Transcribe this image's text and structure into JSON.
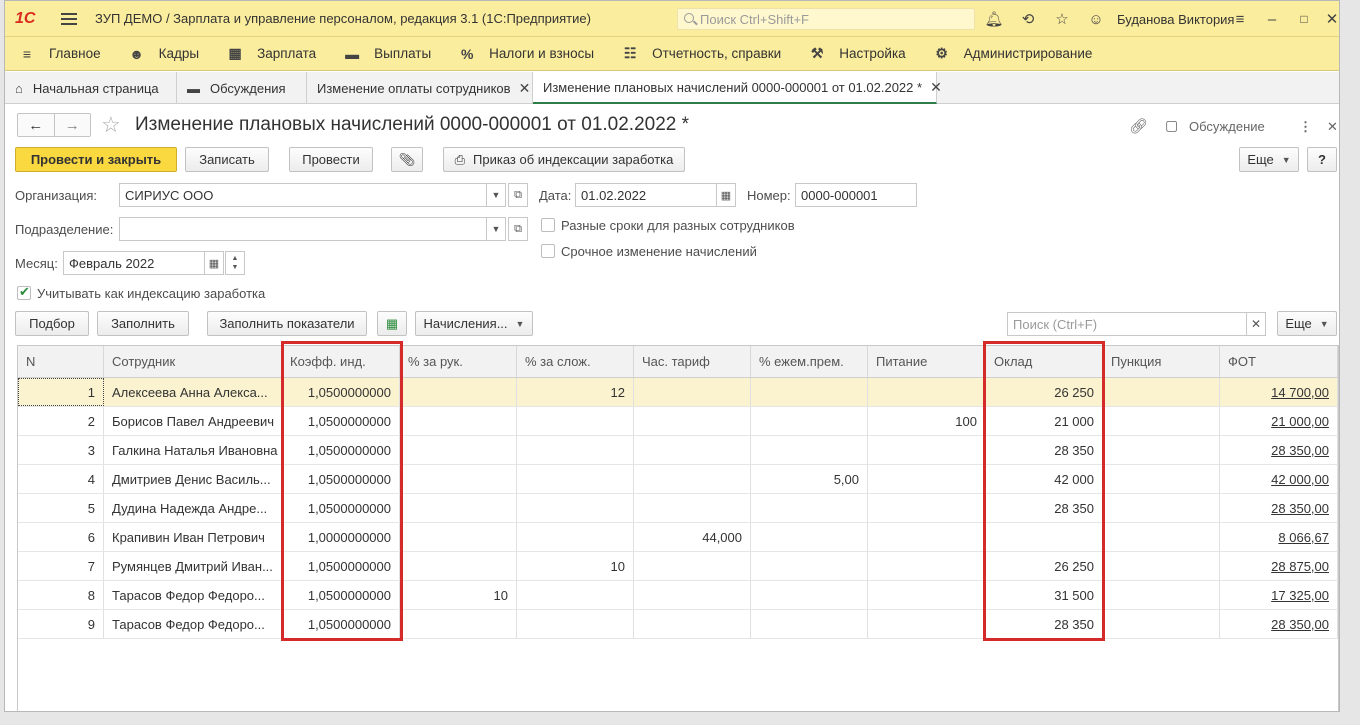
{
  "titlebar": {
    "logo": "1С",
    "title": "ЗУП ДЕМО / Зарплата и управление персоналом, редакция 3.1  (1С:Предприятие)",
    "search_placeholder": "Поиск Ctrl+Shift+F",
    "user": "Буданова Виктория"
  },
  "menu": [
    {
      "label": "Главное",
      "icon": "menu-icon"
    },
    {
      "label": "Кадры",
      "icon": "people-icon"
    },
    {
      "label": "Зарплата",
      "icon": "calculator-icon"
    },
    {
      "label": "Выплаты",
      "icon": "wallet-icon"
    },
    {
      "label": "Налоги и взносы",
      "icon": "percent-icon"
    },
    {
      "label": "Отчетность, справки",
      "icon": "report-icon"
    },
    {
      "label": "Настройка",
      "icon": "wrench-icon"
    },
    {
      "label": "Администрирование",
      "icon": "gear-icon"
    }
  ],
  "tabs": [
    {
      "label": "Начальная страница"
    },
    {
      "label": "Обсуждения"
    },
    {
      "label": "Изменение оплаты сотрудников"
    },
    {
      "label": "Изменение плановых начислений 0000-000001 от 01.02.2022 *"
    }
  ],
  "form": {
    "title": "Изменение плановых начислений 0000-000001 от 01.02.2022 *",
    "discussion": "Обсуждение",
    "buttons": {
      "post_close": "Провести и закрыть",
      "save": "Записать",
      "post": "Провести",
      "order": "Приказ об индексации заработка",
      "more": "Еще",
      "help": "?"
    },
    "org_label": "Организация:",
    "org_value": "СИРИУС ООО",
    "date_label": "Дата:",
    "date_value": "01.02.2022",
    "number_label": "Номер:",
    "number_value": "0000-000001",
    "dept_label": "Подразделение:",
    "dept_value": "",
    "check_terms": "Разные сроки для разных сотрудников",
    "check_urgent": "Срочное изменение начислений",
    "month_label": "Месяц:",
    "month_value": "Февраль 2022",
    "check_indexation": "Учитывать как индексацию заработка"
  },
  "table_toolbar": {
    "pick": "Подбор",
    "fill": "Заполнить",
    "fill_indicators": "Заполнить показатели",
    "accruals": "Начисления...",
    "search_placeholder": "Поиск (Ctrl+F)",
    "more": "Еще"
  },
  "table": {
    "columns": [
      "N",
      "Сотрудник",
      "Коэфф. инд.",
      "% за рук.",
      "% за слож.",
      "Час. тариф",
      "% ежем.прем.",
      "Питание",
      "Оклад",
      "Пункция",
      "ФОТ"
    ],
    "rows": [
      [
        "1",
        "Алексеева Анна Алекса...",
        "1,0500000000",
        "",
        "12",
        "",
        "",
        "",
        "26 250",
        "",
        "14 700,00"
      ],
      [
        "2",
        "Борисов Павел Андреевич",
        "1,0500000000",
        "",
        "",
        "",
        "",
        "100",
        "21 000",
        "",
        "21 000,00"
      ],
      [
        "3",
        "Галкина Наталья Ивановна",
        "1,0500000000",
        "",
        "",
        "",
        "",
        "",
        "28 350",
        "",
        "28 350,00"
      ],
      [
        "4",
        "Дмитриев Денис Василь...",
        "1,0500000000",
        "",
        "",
        "",
        "5,00",
        "",
        "42 000",
        "",
        "42 000,00"
      ],
      [
        "5",
        "Дудина Надежда Андре...",
        "1,0500000000",
        "",
        "",
        "",
        "",
        "",
        "28 350",
        "",
        "28 350,00"
      ],
      [
        "6",
        "Крапивин Иван Петрович",
        "1,0000000000",
        "",
        "",
        "44,000",
        "",
        "",
        "",
        "",
        "8 066,67"
      ],
      [
        "7",
        "Румянцев Дмитрий Иван...",
        "1,0500000000",
        "",
        "10",
        "",
        "",
        "",
        "26 250",
        "",
        "28 875,00"
      ],
      [
        "8",
        "Тарасов Федор Федоро...",
        "1,0500000000",
        "10",
        "",
        "",
        "",
        "",
        "31 500",
        "",
        "17 325,00"
      ],
      [
        "9",
        "Тарасов Федор Федоро...",
        "1,0500000000",
        "",
        "",
        "",
        "",
        "",
        "28 350",
        "",
        "28 350,00"
      ]
    ]
  },
  "colors": {
    "header_yellow": "#fbed9e",
    "primary_button": "#f9d840",
    "highlight_red": "#d42a2a",
    "selected_row": "#fbf3cf"
  }
}
